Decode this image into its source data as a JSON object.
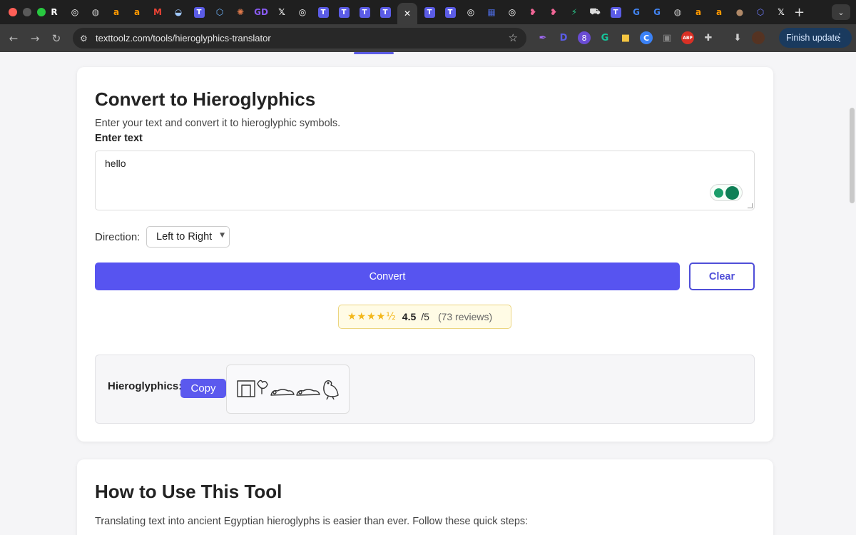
{
  "browser": {
    "traffic_colors": [
      "#ff5f57",
      "#5a5a5a",
      "#28c840"
    ],
    "tabs": [
      {
        "icon": "roblox-icon",
        "glyph": "R",
        "color": "#ffffff"
      },
      {
        "icon": "openai-icon",
        "glyph": "◎",
        "color": "#ffffff"
      },
      {
        "icon": "globe-icon",
        "glyph": "◍",
        "color": "#cccccc"
      },
      {
        "icon": "amazon-icon",
        "glyph": "a",
        "color": "#ff9900"
      },
      {
        "icon": "amazon-icon",
        "glyph": "a",
        "color": "#ff9900"
      },
      {
        "icon": "gmail-icon",
        "glyph": "M",
        "color": "#ea4335"
      },
      {
        "icon": "swift-icon",
        "glyph": "◒",
        "color": "#a0c8ff"
      },
      {
        "icon": "texttoolz-icon",
        "glyph": "T",
        "color": "#5b5ce6"
      },
      {
        "icon": "hexagon-icon",
        "glyph": "⬡",
        "color": "#6fb6ff"
      },
      {
        "icon": "claude-icon",
        "glyph": "✺",
        "color": "#e07a4b"
      },
      {
        "icon": "gd-icon",
        "glyph": "GD",
        "color": "#8b5cf6"
      },
      {
        "icon": "x-icon",
        "glyph": "𝕏",
        "color": "#ffffff"
      },
      {
        "icon": "openai-icon",
        "glyph": "◎",
        "color": "#ffffff"
      },
      {
        "icon": "texttoolz-icon",
        "glyph": "T",
        "color": "#5b5ce6"
      },
      {
        "icon": "texttoolz-icon",
        "glyph": "T",
        "color": "#5b5ce6"
      },
      {
        "icon": "texttoolz-icon",
        "glyph": "T",
        "color": "#5b5ce6"
      },
      {
        "icon": "texttoolz-icon",
        "glyph": "T",
        "color": "#5b5ce6"
      },
      {
        "icon": "close-icon",
        "glyph": "✕",
        "color": "#ffffff",
        "active": true
      },
      {
        "icon": "texttoolz-icon",
        "glyph": "T",
        "color": "#5b5ce6"
      },
      {
        "icon": "texttoolz-icon",
        "glyph": "T",
        "color": "#5b5ce6"
      },
      {
        "icon": "openai-icon",
        "glyph": "◎",
        "color": "#ffffff"
      },
      {
        "icon": "dashboard-icon",
        "glyph": "▦",
        "color": "#4a67d6"
      },
      {
        "icon": "openai-icon",
        "glyph": "◎",
        "color": "#ffffff"
      },
      {
        "icon": "heart-icon",
        "glyph": "❥",
        "color": "#f06595"
      },
      {
        "icon": "heart-icon",
        "glyph": "❥",
        "color": "#f06595"
      },
      {
        "icon": "bolt-icon",
        "glyph": "⚡",
        "color": "#2bc48a"
      },
      {
        "icon": "car-icon",
        "glyph": "⛟",
        "color": "#dddddd"
      },
      {
        "icon": "texttoolz-icon",
        "glyph": "T",
        "color": "#5b5ce6"
      },
      {
        "icon": "google-icon",
        "glyph": "G",
        "color": "#4285f4"
      },
      {
        "icon": "google-icon",
        "glyph": "G",
        "color": "#4285f4"
      },
      {
        "icon": "globe-icon",
        "glyph": "◍",
        "color": "#cccccc"
      },
      {
        "icon": "amazon-icon",
        "glyph": "a",
        "color": "#ff9900"
      },
      {
        "icon": "amazon-icon",
        "glyph": "a",
        "color": "#ff9900"
      },
      {
        "icon": "avatar-icon",
        "glyph": "●",
        "color": "#b08968"
      },
      {
        "icon": "hexagon-icon",
        "glyph": "⬡",
        "color": "#6f7cff"
      },
      {
        "icon": "x-icon",
        "glyph": "𝕏",
        "color": "#ffffff"
      }
    ],
    "new_tab": "+",
    "url": "texttoolz.com/tools/hieroglyphics-translator",
    "finish_update": "Finish update",
    "extensions": [
      {
        "icon": "feather-icon",
        "glyph": "✒",
        "color": "#a56cff"
      },
      {
        "icon": "d-icon",
        "glyph": "D",
        "color": "#5b5ce6"
      },
      {
        "icon": "badge-icon",
        "glyph": "8",
        "color": "#6a4cd4"
      },
      {
        "icon": "grammarly-icon",
        "glyph": "G",
        "color": "#15c39a"
      },
      {
        "icon": "note-icon",
        "glyph": "■",
        "color": "#f4c542"
      },
      {
        "icon": "c-icon",
        "glyph": "C",
        "color": "#3b82f6"
      },
      {
        "icon": "screenshot-icon",
        "glyph": "▣",
        "color": "#888888"
      },
      {
        "icon": "adblock-icon",
        "glyph": "ABP",
        "color": "#d93025"
      },
      {
        "icon": "puzzle-icon",
        "glyph": "✚",
        "color": "#cccccc"
      },
      {
        "icon": "download-icon",
        "glyph": "⬇",
        "color": "#cccccc"
      },
      {
        "icon": "profile-icon",
        "glyph": "●",
        "color": "#553322"
      }
    ]
  },
  "tool": {
    "title": "Convert to Hieroglyphics",
    "subtitle": "Enter your text and convert it to hieroglyphic symbols.",
    "input_label": "Enter text",
    "input_value": "hello",
    "direction_label": "Direction:",
    "direction_value": "Left to Right",
    "convert_label": "Convert",
    "clear_label": "Clear",
    "rating": {
      "stars": "★★★★½",
      "score": "4.5",
      "out_of": "/5",
      "reviews": "(73 reviews)"
    },
    "result": {
      "label": "Hieroglyphics:",
      "copy_label": "Copy"
    }
  },
  "howto": {
    "title": "How to Use This Tool",
    "intro": "Translating text into ancient Egyptian hieroglyphs is easier than ever. Follow these quick steps:"
  }
}
